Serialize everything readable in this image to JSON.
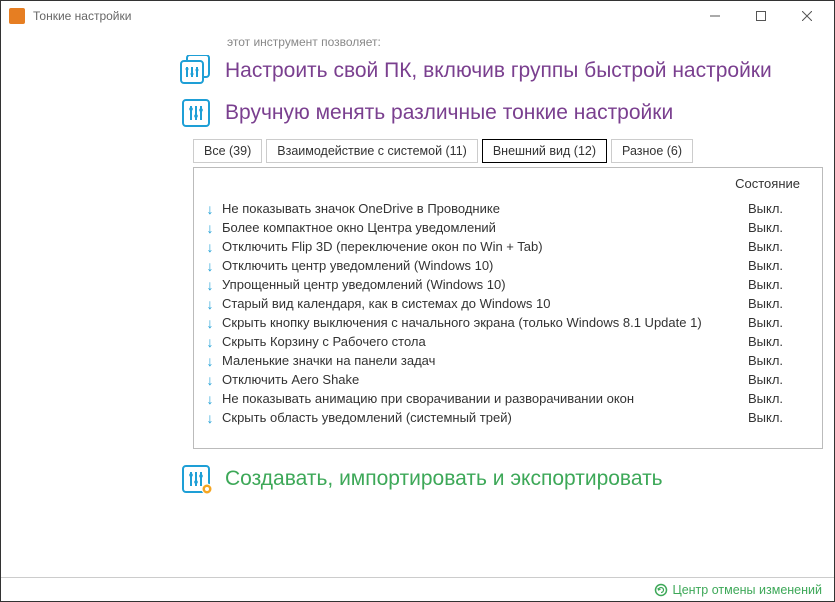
{
  "window": {
    "title": "Тонкие настройки"
  },
  "intro": "этот инструмент позволяет:",
  "sections": {
    "configure": "Настроить свой ПК, включив группы быстрой настройки",
    "manual": "Вручную менять различные тонкие настройки",
    "export": "Создавать, импортировать и экспортировать"
  },
  "tabs": [
    {
      "label": "Все (39)",
      "active": false
    },
    {
      "label": "Взаимодействие с системой (11)",
      "active": false
    },
    {
      "label": "Внешний вид (12)",
      "active": true
    },
    {
      "label": "Разное (6)",
      "active": false
    }
  ],
  "list_header": "Состояние",
  "settings": [
    {
      "name": "Не показывать значок OneDrive в Проводнике",
      "status": "Выкл."
    },
    {
      "name": "Более компактное окно Центра уведомлений",
      "status": "Выкл."
    },
    {
      "name": "Отключить Flip 3D (переключение окон по Win + Tab)",
      "status": "Выкл."
    },
    {
      "name": "Отключить центр уведомлений (Windows 10)",
      "status": "Выкл."
    },
    {
      "name": "Упрощенный центр уведомлений (Windows 10)",
      "status": "Выкл."
    },
    {
      "name": "Старый вид календаря, как в системах до Windows 10",
      "status": "Выкл."
    },
    {
      "name": "Скрыть кнопку выключения с начального экрана (только Windows 8.1 Update 1)",
      "status": "Выкл."
    },
    {
      "name": "Скрыть Корзину с Рабочего стола",
      "status": "Выкл."
    },
    {
      "name": "Маленькие значки на панели задач",
      "status": "Выкл."
    },
    {
      "name": "Отключить Aero Shake",
      "status": "Выкл."
    },
    {
      "name": "Не показывать анимацию при сворачивании и разворачивании окон",
      "status": "Выкл."
    },
    {
      "name": "Скрыть область уведомлений (системный трей)",
      "status": "Выкл."
    }
  ],
  "restore": "Центр отмены изменений"
}
